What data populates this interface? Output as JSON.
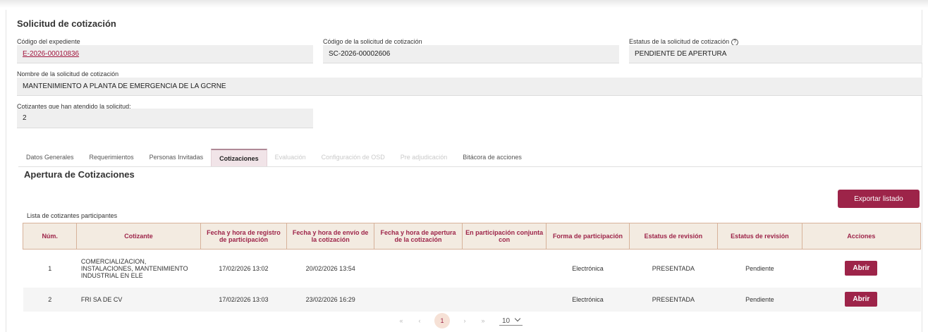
{
  "page_title": "Solicitud de cotización",
  "fields": {
    "expediente_label": "Código del expediente",
    "expediente_value": "E-2026-00010836",
    "solicitud_label": "Código de la solicitud de cotización",
    "solicitud_value": "SC-2026-00002606",
    "estatus_label": "Estatus de la solicitud de cotización",
    "estatus_help_icon": "?",
    "estatus_value": "PENDIENTE DE APERTURA",
    "nombre_label": "Nombre de la solicitud de cotización",
    "nombre_value": "MANTENIMIENTO A PLANTA DE EMERGENCIA DE LA GCRNE",
    "cotizantes_label": "Cotizantes que han atendido la solicitud:",
    "cotizantes_value": "2"
  },
  "tabs": [
    {
      "label": "Datos Generales",
      "state": "normal"
    },
    {
      "label": "Requerimientos",
      "state": "normal"
    },
    {
      "label": "Personas Invitadas",
      "state": "normal"
    },
    {
      "label": "Cotizaciones",
      "state": "active"
    },
    {
      "label": "Evaluación",
      "state": "disabled"
    },
    {
      "label": "Configuración de OSD",
      "state": "disabled"
    },
    {
      "label": "Pre adjudicación",
      "state": "disabled"
    },
    {
      "label": "Bitácora de acciones",
      "state": "normal"
    }
  ],
  "section_title": "Apertura de Cotizaciones",
  "export_label": "Exportar listado",
  "list_title": "Lista de cotizantes participantes",
  "table": {
    "headers": [
      "Núm.",
      "Cotizante",
      "Fecha y hora de registro de participación",
      "Fecha y hora de envío de la cotización",
      "Fecha y hora de apertura de la cotización",
      "En participación conjunta con",
      "Forma de participación",
      "Estatus de revisión",
      "Estatus de revisión",
      "Acciones"
    ],
    "rows": [
      {
        "num": "1",
        "cotizante": "COMERCIALIZACION, INSTALACIONES, MANTENIMIENTO INDUSTRIAL EN ELE",
        "registro": "17/02/2026 13:02",
        "envio": "20/02/2026 13:54",
        "apertura": "",
        "conjunta": "",
        "forma": "Electrónica",
        "estatus": "PRESENTADA",
        "estatus2": "Pendiente",
        "accion": "Abrir"
      },
      {
        "num": "2",
        "cotizante": "FRI SA DE CV",
        "registro": "17/02/2026 13:03",
        "envio": "23/02/2026 16:29",
        "apertura": "",
        "conjunta": "",
        "forma": "Electrónica",
        "estatus": "PRESENTADA",
        "estatus2": "Pendiente",
        "accion": "Abrir"
      }
    ]
  },
  "pagination": {
    "first": "«",
    "prev": "‹",
    "current": "1",
    "next": "›",
    "last": "»",
    "page_size": "10"
  },
  "colors": {
    "accent": "#9d2449",
    "header_bg": "#f3ebe1"
  }
}
